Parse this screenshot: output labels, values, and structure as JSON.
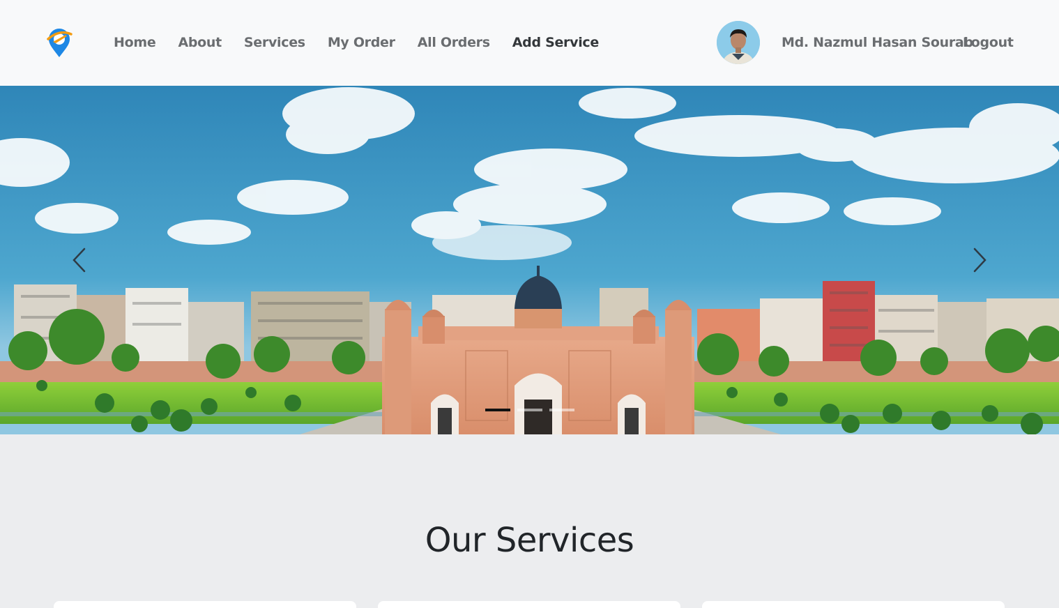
{
  "nav": {
    "links": [
      {
        "label": "Home"
      },
      {
        "label": "About"
      },
      {
        "label": "Services"
      },
      {
        "label": "My Order"
      },
      {
        "label": "All Orders"
      },
      {
        "label": "Add Service"
      }
    ],
    "user_name": "Md. Nazmul Hasan Sourab",
    "logout_label": "Logout"
  },
  "carousel": {
    "active_index": 0,
    "slide_count": 3,
    "prev_icon": "chevron-left-icon",
    "next_icon": "chevron-right-icon"
  },
  "services": {
    "title": "Our Services",
    "card_count": 3
  },
  "colors": {
    "nav_bg": "#f8f9fa",
    "page_bg": "#ecedef",
    "nav_text": "#6a6d70",
    "logo_blue": "#1e88e5",
    "logo_orange": "#f39c12"
  }
}
